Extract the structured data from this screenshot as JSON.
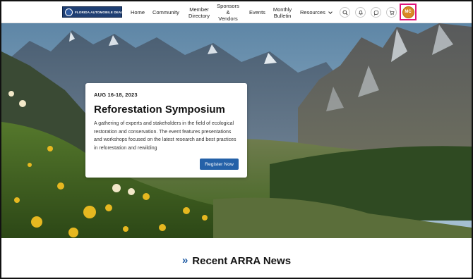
{
  "header": {
    "logo_alt": "FLORIDA AUTOMOBILE DEALERS ASSOCIATION",
    "nav": [
      {
        "label": "Home"
      },
      {
        "label": "Community"
      },
      {
        "label": "Member Directory"
      },
      {
        "label": "Sponsors & Vendors"
      },
      {
        "label": "Events"
      },
      {
        "label": "Monthly Bulletin"
      },
      {
        "label": "Resources"
      }
    ],
    "icons": [
      "search-icon",
      "bell-icon",
      "chat-icon",
      "cart-icon"
    ],
    "avatar_initials": "MC",
    "highlight_color": "#e0147a"
  },
  "hero": {
    "date": "AUG 16-18, 2023",
    "title": "Reforestation Symposium",
    "description": "A gathering of experts and stakeholders in the field of ecological restoration and conservation. The event features presentations and workshops focused on the latest research and best practices in reforestation and rewilding",
    "button_label": "Register Now"
  },
  "news": {
    "chevron": "»",
    "title": "Recent ARRA News"
  },
  "colors": {
    "primary": "#2461a8",
    "avatar": "#d98a25"
  }
}
